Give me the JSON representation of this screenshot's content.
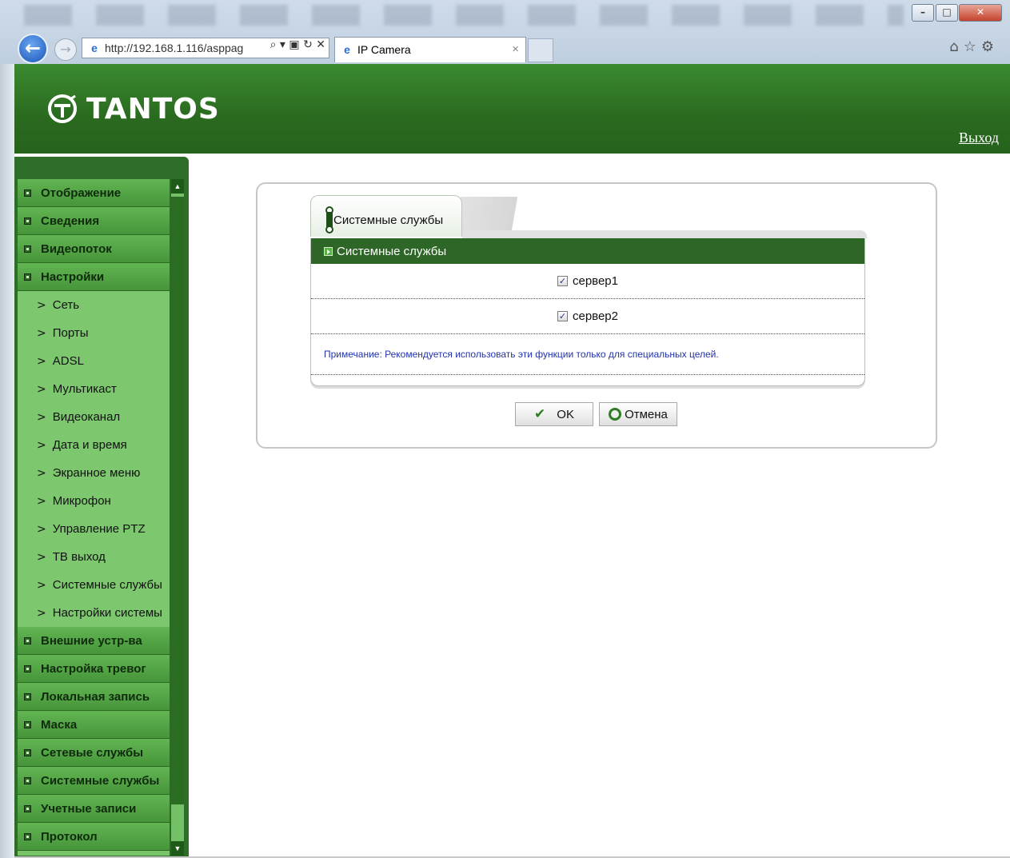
{
  "browser": {
    "address": "http://192.168.1.116/asppag",
    "address_host": "192.168.1.116",
    "tab_title": "IP Camera",
    "close_tab": "×"
  },
  "header": {
    "logo": "TANTOS",
    "logout": "Выход"
  },
  "sidebar": {
    "items": [
      {
        "label": "Отображение"
      },
      {
        "label": "Сведения"
      },
      {
        "label": "Видеопоток"
      },
      {
        "label": "Настройки"
      }
    ],
    "sub_items": [
      {
        "label": "Сеть"
      },
      {
        "label": "Порты"
      },
      {
        "label": "ADSL"
      },
      {
        "label": "Мультикаст"
      },
      {
        "label": "Видеоканал"
      },
      {
        "label": "Дата и время"
      },
      {
        "label": "Экранное меню"
      },
      {
        "label": "Микрофон"
      },
      {
        "label": "Управление PTZ"
      },
      {
        "label": "ТВ выход"
      },
      {
        "label": "Системные службы"
      },
      {
        "label": "Настройки системы"
      }
    ],
    "items_after": [
      {
        "label": "Внешние устр-ва"
      },
      {
        "label": "Настройка тревог"
      },
      {
        "label": "Локальная запись"
      },
      {
        "label": "Маска"
      },
      {
        "label": "Сетевые службы"
      },
      {
        "label": "Системные службы"
      },
      {
        "label": "Учетные записи"
      },
      {
        "label": "Протокол"
      }
    ]
  },
  "main": {
    "tab_label": "Системные службы",
    "section_title": "Системные службы",
    "options": [
      {
        "label": "сервер1",
        "checked": true
      },
      {
        "label": "сервер2",
        "checked": true
      }
    ],
    "note": "Примечание: Рекомендуется использовать эти функции только для специальных целей.",
    "ok_label": "OK",
    "cancel_label": "Отмена"
  },
  "colors": {
    "brand_green": "#2d6626",
    "menu_green": "#62b552",
    "note_text": "#2233aa"
  }
}
